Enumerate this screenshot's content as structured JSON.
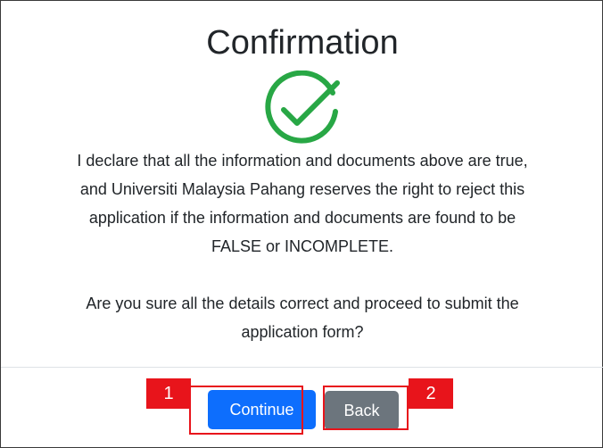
{
  "dialog": {
    "title": "Confirmation",
    "status_icon": "check-circle-icon",
    "declaration_lines": [
      "I declare that all the information and documents above are true,",
      "and Universiti Malaysia Pahang reserves the right to reject this",
      "application if the information and documents are found to be",
      "FALSE or INCOMPLETE."
    ],
    "question_lines": [
      "Are you sure all the details correct and proceed to submit the",
      "application form?"
    ]
  },
  "buttons": {
    "continue_label": "Continue",
    "back_label": "Back"
  },
  "annotations": {
    "marker_1": "1",
    "marker_2": "2"
  },
  "colors": {
    "success": "#28a745",
    "primary": "#0d6efd",
    "secondary": "#6c757d",
    "annotation": "#e8141b"
  }
}
